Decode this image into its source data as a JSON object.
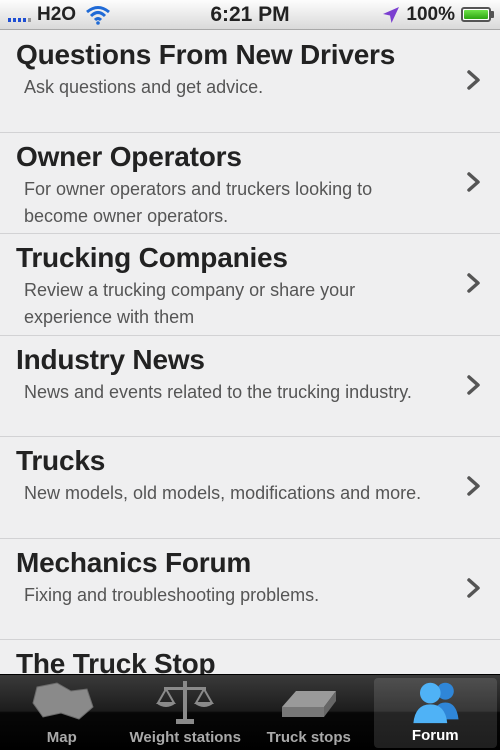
{
  "status_bar": {
    "carrier": "H2O",
    "time": "6:21 PM",
    "battery": "100%"
  },
  "forums": [
    {
      "title": "Questions From New Drivers",
      "description": "Ask questions and get advice."
    },
    {
      "title": "Owner Operators",
      "description": "For owner operators and truckers looking to become owner operators."
    },
    {
      "title": "Trucking Companies",
      "description": "Review a trucking company or share your experience with them"
    },
    {
      "title": "Industry News",
      "description": "News and events related to the trucking industry."
    },
    {
      "title": "Trucks",
      "description": "New models, old models, modifications and more."
    },
    {
      "title": "Mechanics Forum",
      "description": "Fixing and troubleshooting problems."
    },
    {
      "title": "The Truck Stop",
      "description": ""
    }
  ],
  "tabs": [
    {
      "label": "Map",
      "icon": "map-icon",
      "active": false
    },
    {
      "label": "Weight stations",
      "icon": "scale-icon",
      "active": false
    },
    {
      "label": "Truck stops",
      "icon": "truck-icon",
      "active": false
    },
    {
      "label": "Forum",
      "icon": "people-icon",
      "active": true
    }
  ],
  "colors": {
    "tab_active_icon": "#3aa0f0",
    "tab_inactive_icon": "#8a8a8a",
    "signal": "#1f4fd3",
    "battery": "#3cc21b",
    "location_arrow": "#7b3fd0"
  }
}
